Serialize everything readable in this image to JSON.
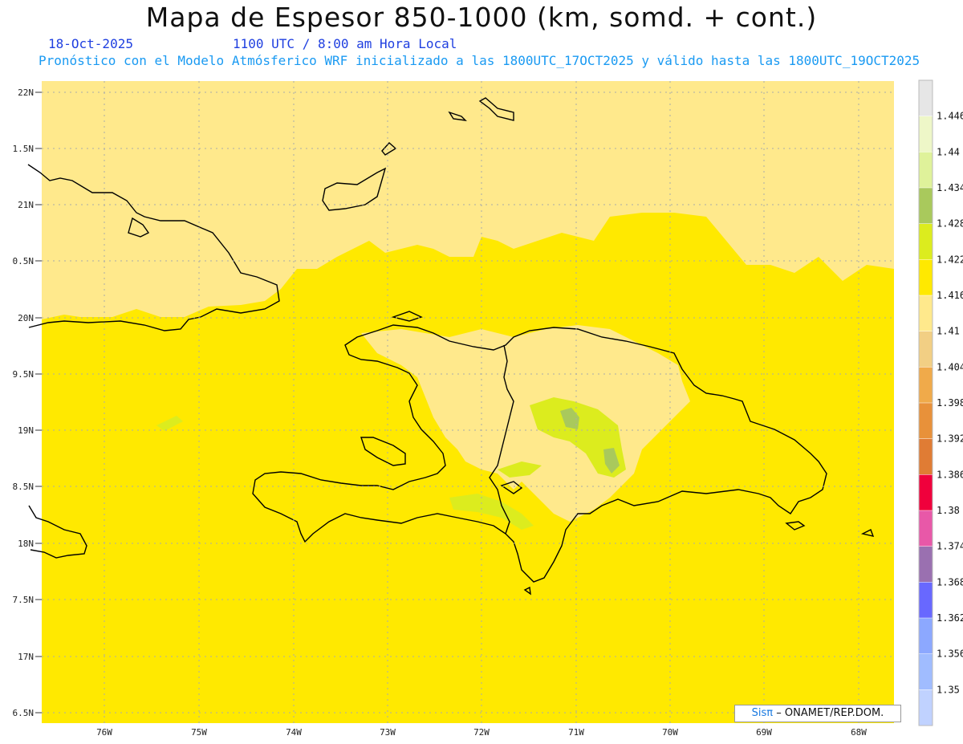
{
  "header": {
    "title": "Mapa de Espesor 850-1000 (km, somd. + cont.)",
    "date": "18-Oct-2025",
    "time": "1100 UTC / 8:00 am Hora Local",
    "description": "Pronóstico con el Modelo Atmósferico WRF inicializado a las 1800UTC_17OCT2025 y válido hasta las  1800UTC_19OCT2025"
  },
  "lat_labels": [
    "22N",
    "1.5N",
    "21N",
    "0.5N",
    "20N",
    "9.5N",
    "19N",
    "8.5N",
    "18N",
    "7.5N",
    "17N",
    "6.5N"
  ],
  "lon_labels": [
    "76W",
    "75W",
    "74W",
    "73W",
    "72W",
    "71W",
    "70W",
    "69W",
    "68W"
  ],
  "colorbar": {
    "labels": [
      "1.446",
      "1.44",
      "1.434",
      "1.428",
      "1.422",
      "1.416",
      "1.41",
      "1.404",
      "1.398",
      "1.392",
      "1.386",
      "1.38",
      "1.374",
      "1.368",
      "1.362",
      "1.356",
      "1.35"
    ],
    "colors": [
      "#e6e6e6",
      "#eef7c8",
      "#dff29a",
      "#a9c95c",
      "#dcec1e",
      "#ffe900",
      "#ffe98c",
      "#f2cf84",
      "#f0aa4a",
      "#e8913a",
      "#e07c34",
      "#f0003c",
      "#e858a8",
      "#9a70b0",
      "#6868ff",
      "#8ca8ff",
      "#a0bcff",
      "#c0d2ff"
    ]
  },
  "credit": {
    "brand": "Sisπ",
    "text": "– ONAMET/REP.DOM."
  },
  "colors": {
    "base_field": "#ffe900",
    "light_field": "#ffe98c",
    "green_field": "#dcec1e",
    "dark_green_field": "#a9c95c"
  }
}
